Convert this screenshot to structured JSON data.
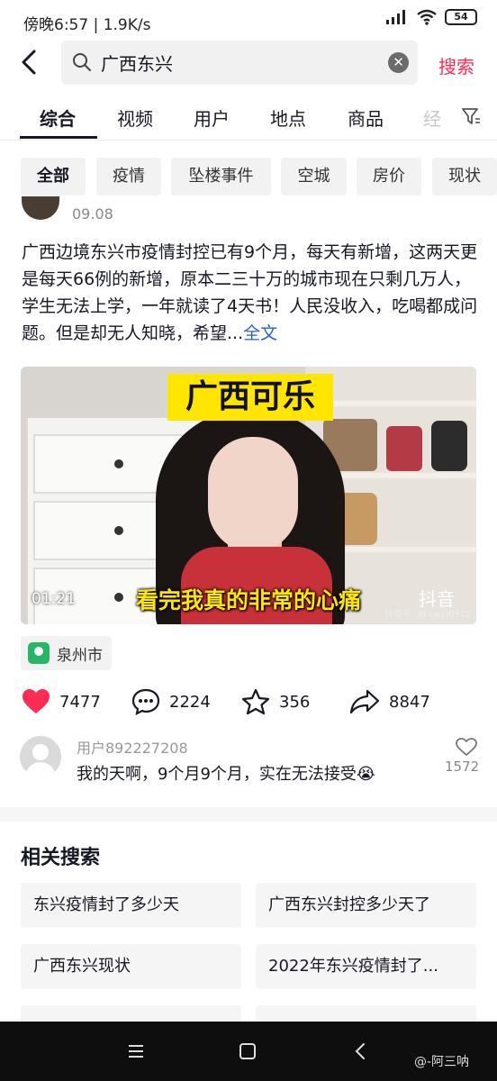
{
  "status_bar": {
    "time": "傍晚6:57 | 1.9K/s",
    "battery": "54"
  },
  "search": {
    "query": "广西东兴",
    "button": "搜索"
  },
  "tabs": [
    "综合",
    "视频",
    "用户",
    "地点",
    "商品",
    "经"
  ],
  "chips": [
    "全部",
    "疫情",
    "坠楼事件",
    "空城",
    "房价",
    "现状"
  ],
  "post": {
    "date": "09.08",
    "description": "广西边境东兴市疫情封控已有9个月，每天有新增，这两天更是每天66例的新增，原本二三十万的城市现在只剩几万人，学生无法上学，一年就读了4天书！人民没收入，吃喝都成问题。但是却无人知晓，希望...",
    "more": "全文",
    "video": {
      "banner": "广西可乐",
      "subtitle": "看完我真的非常的心痛",
      "duration": "01:21",
      "logo_text": "抖音",
      "douyin_id": "抖音号: xkxwyj0922"
    },
    "location": "泉州市",
    "actions": {
      "likes": "7477",
      "comments": "2224",
      "favorites": "356",
      "shares": "8847"
    },
    "comment": {
      "user": "用户892227208",
      "text": "我的天啊，9个月9个月，实在无法接受😭",
      "likes": "1572"
    }
  },
  "related": {
    "title": "相关搜索",
    "items": [
      "东兴疫情封了多少天",
      "广西东兴封控多少天了",
      "广西东兴现状",
      "2022年东兴疫情封了..."
    ]
  },
  "watermark": "@-阿三呐",
  "colors": {
    "accent": "#fe2c55",
    "link": "#2a61c9",
    "banner": "#ffe600"
  }
}
